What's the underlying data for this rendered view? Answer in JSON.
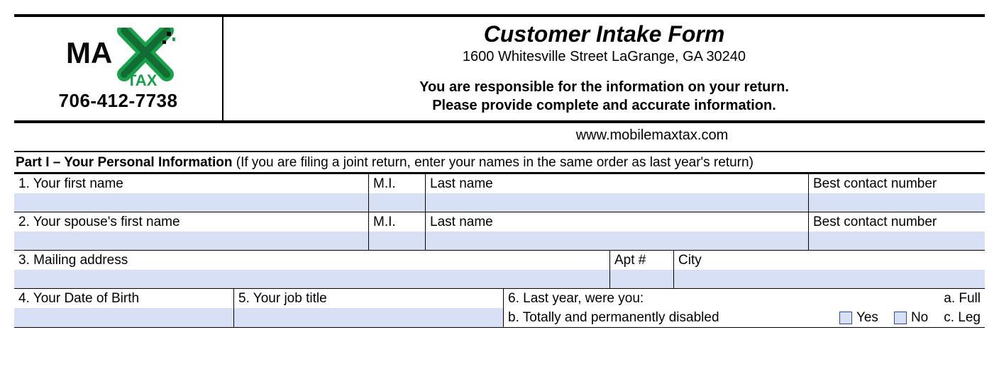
{
  "header": {
    "phone": "706-412-7738",
    "title": "Customer Intake Form",
    "address": "1600 Whitesville Street LaGrange, GA 30240",
    "disclaimer1": "You are responsible for the information on your return.",
    "disclaimer2": "Please provide complete and accurate information.",
    "website": "www.mobilemaxtax.com",
    "logo_main": "MA",
    "logo_sub": "TAX"
  },
  "part1": {
    "title": "Part I – Your Personal Information",
    "note": "(If you are filing a joint return, enter your names in the same order as last year's return)",
    "row1": {
      "first": "1. Your first name",
      "mi": "M.I.",
      "last": "Last name",
      "contact": "Best contact number"
    },
    "row2": {
      "first": "2. Your spouse's first name",
      "mi": "M.I.",
      "last": "Last name",
      "contact": "Best contact number"
    },
    "row3": {
      "mail": "3. Mailing address",
      "apt": "Apt #",
      "city": "City"
    },
    "row4": {
      "dob": "4. Your Date of Birth",
      "job": "5. Your job title",
      "q6a": "6. Last year, were you:",
      "q6a_tail": "a. Full",
      "q6b": "b. Totally and permanently disabled",
      "yes": "Yes",
      "no": "No",
      "q6b_tail": "c. Leg"
    }
  }
}
